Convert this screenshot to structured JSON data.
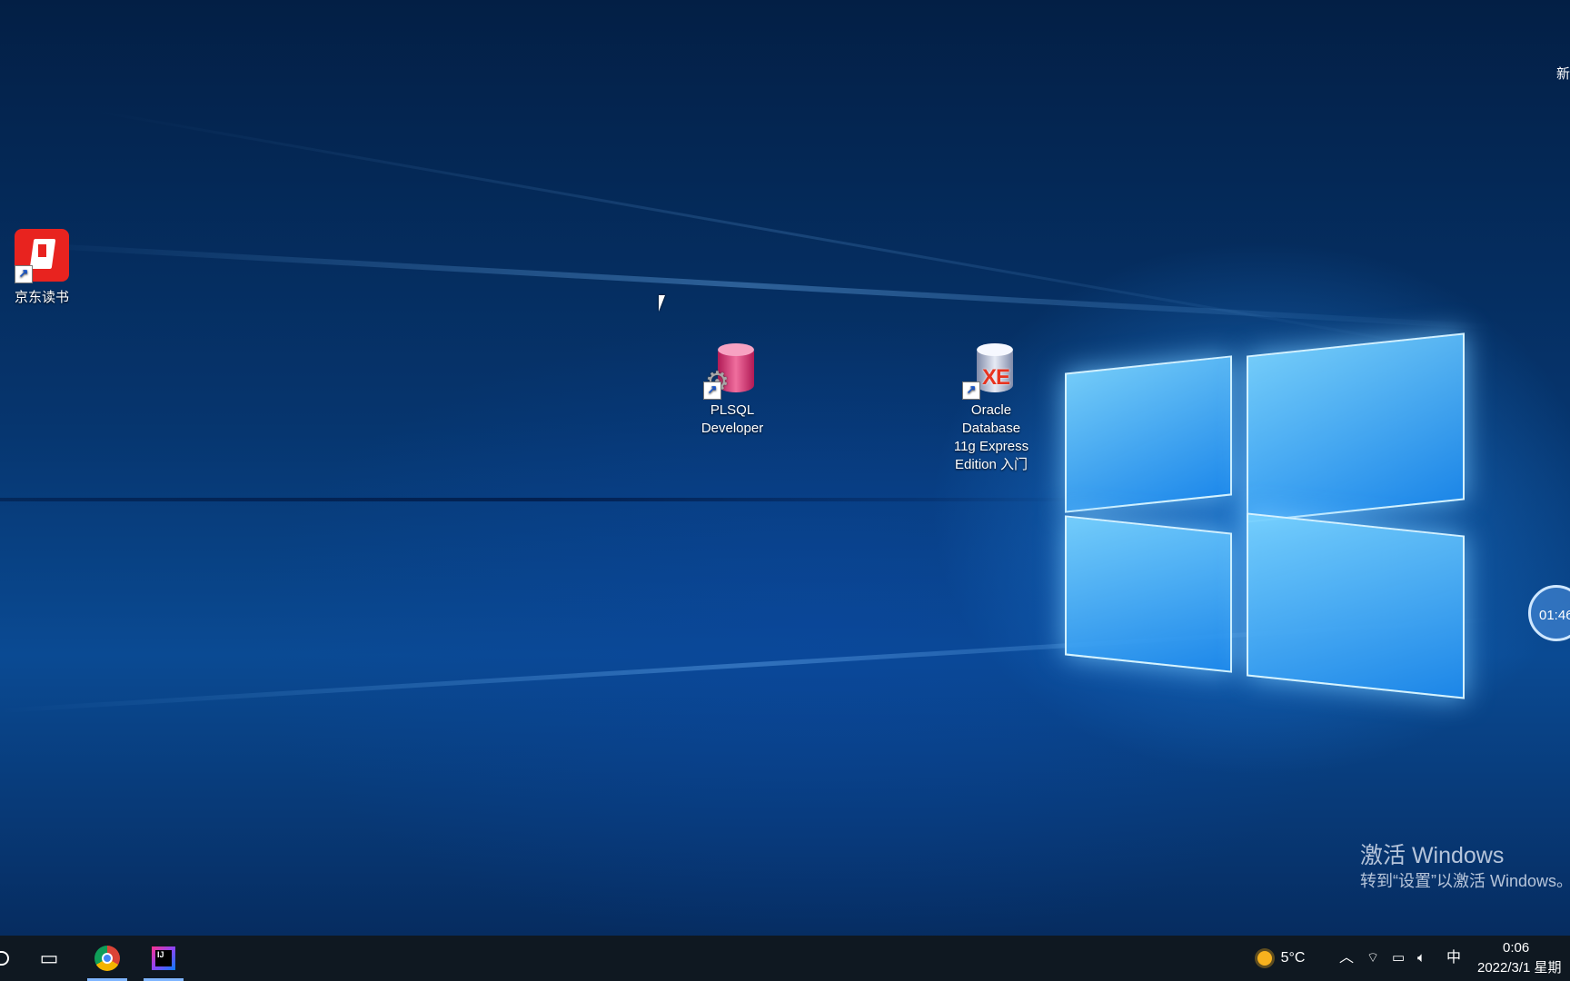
{
  "desktop": {
    "icons": [
      {
        "label": "京东读书",
        "icon": "jd-reader-icon"
      },
      {
        "label_lines": [
          "PLSQL",
          "Developer"
        ],
        "icon": "plsql-developer-icon"
      },
      {
        "label_lines": [
          "Oracle",
          "Database",
          "11g Express",
          "Edition 入门"
        ],
        "icon": "oracle-xe-icon"
      }
    ],
    "edge_text": "新",
    "timer_text": "01:46",
    "activation": {
      "title": "激活 Windows",
      "subtitle": "转到“设置”以激活 Windows。"
    }
  },
  "taskbar": {
    "apps": [
      {
        "name": "task-view",
        "icon": "task-view-icon"
      },
      {
        "name": "chrome",
        "icon": "chrome-icon"
      },
      {
        "name": "intellij-idea",
        "icon": "intellij-idea-icon",
        "badge": "IJ"
      }
    ],
    "weather": {
      "temp": "5°C",
      "icon": "sun-icon"
    },
    "ime": "中",
    "clock": {
      "time": "0:06",
      "date": "2022/3/1 星期"
    }
  }
}
